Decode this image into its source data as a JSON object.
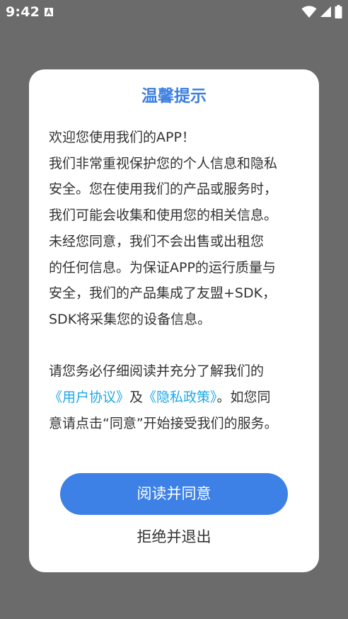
{
  "status_bar": {
    "time": "9:42",
    "notification_icon": "a-icon",
    "wifi_icon": "wifi-icon",
    "signal_icon": "signal-icon",
    "battery_icon": "battery-icon",
    "text_color": "#ffffff"
  },
  "dialog": {
    "title": "温馨提示",
    "paragraph1": [
      "欢迎您使用我们的APP！",
      "我们非常重视保护您的个人信息和隐私",
      "安全。您在使用我们的产品或服务时，",
      "我们可能会收集和使用您的相关信息。",
      "未经您同意，我们不会出售或出租您",
      "的任何信息。为保证APP的运行质量与",
      "安全，我们的产品集成了友盟+SDK，",
      "SDK将采集您的设备信息。"
    ],
    "paragraph2": {
      "line1": "请您务必仔细阅读并充分了解我们的",
      "user_agreement_link": "《用户协议》",
      "and_text": "及",
      "privacy_policy_link": "《隐私政策》",
      "after_links": "。如您同",
      "line3": "意请点击“同意”开始接受我们的服务。"
    },
    "agree_button": "阅读并同意",
    "exit_button": "拒绝并退出"
  },
  "colors": {
    "overlay": "#6b6b6b",
    "title": "#3d7fe0",
    "button": "#3d81e6",
    "link": "#1ea7e6",
    "text": "#333333"
  }
}
